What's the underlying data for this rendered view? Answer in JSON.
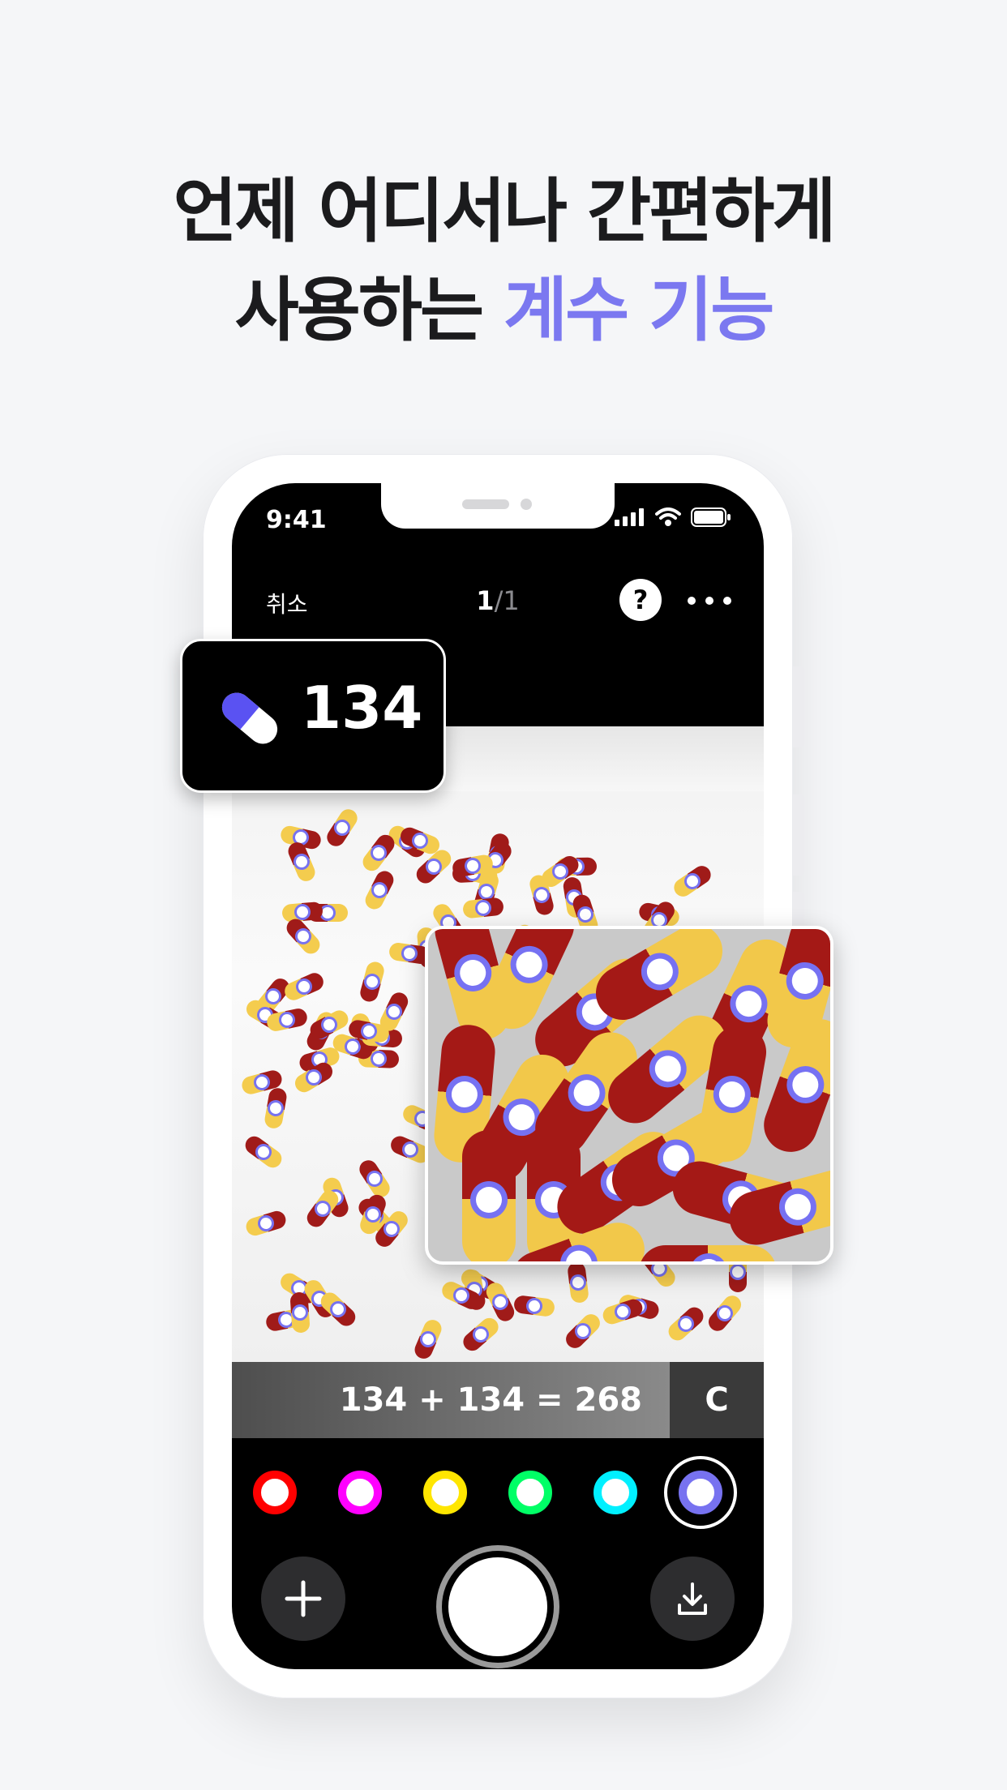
{
  "headline": {
    "line1": "언제 어디서나 간편하게",
    "line2_prefix": "사용하는 ",
    "line2_accent": "계수 기능",
    "accent_color": "#7b78f0"
  },
  "status_bar": {
    "time": "9:41",
    "icons": [
      "cellular-signal-icon",
      "wifi-icon",
      "battery-icon"
    ]
  },
  "topbar": {
    "cancel_label": "취소",
    "page_current": "1",
    "page_total": "/1",
    "help_label": "?",
    "more_icon": "more-dots-icon"
  },
  "count_badge": {
    "icon": "capsule-icon",
    "count": "134"
  },
  "calculator": {
    "expression": "134 + 134 = 268",
    "clear_label": "C"
  },
  "marker_colors": [
    "#ff0000",
    "#ff00ff",
    "#ffe600",
    "#00ff66",
    "#00f0ff",
    "#7772f0"
  ],
  "marker_selected_index": 5,
  "bottom_bar": {
    "add_icon": "plus-icon",
    "shutter_icon": "shutter-button",
    "download_icon": "download-icon"
  }
}
